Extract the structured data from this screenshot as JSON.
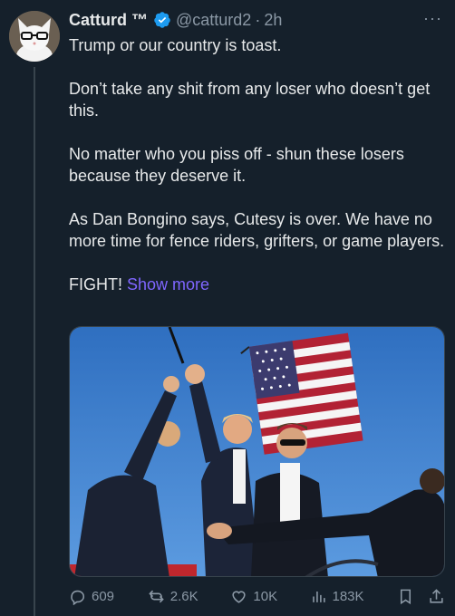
{
  "tweet": {
    "author_name": "Catturd ™",
    "handle": "@catturd2",
    "separator": "·",
    "time": "2h",
    "more_menu": "···",
    "paragraphs": [
      "Trump or our country is toast.",
      "Don’t take any shit from any loser who doesn’t get this.",
      "No matter who you piss off - shun these losers because they deserve it.",
      "As Dan Bongino says, Cutesy is over. We have no more time for fence riders, grifters, or game players."
    ],
    "final_text": "FIGHT!",
    "show_more": "Show more",
    "media_alt": "Photo"
  },
  "actions": {
    "replies": "609",
    "reposts": "2.6K",
    "likes": "10K",
    "views": "183K"
  },
  "colors": {
    "background": "#15202b",
    "text": "#e7e9ea",
    "muted": "#8b98a5",
    "link": "#7f66ff",
    "verified": "#1d9bf0"
  },
  "icons": [
    "verified-icon",
    "more-icon",
    "reply-icon",
    "repost-icon",
    "like-icon",
    "views-icon",
    "bookmark-icon",
    "share-icon"
  ]
}
